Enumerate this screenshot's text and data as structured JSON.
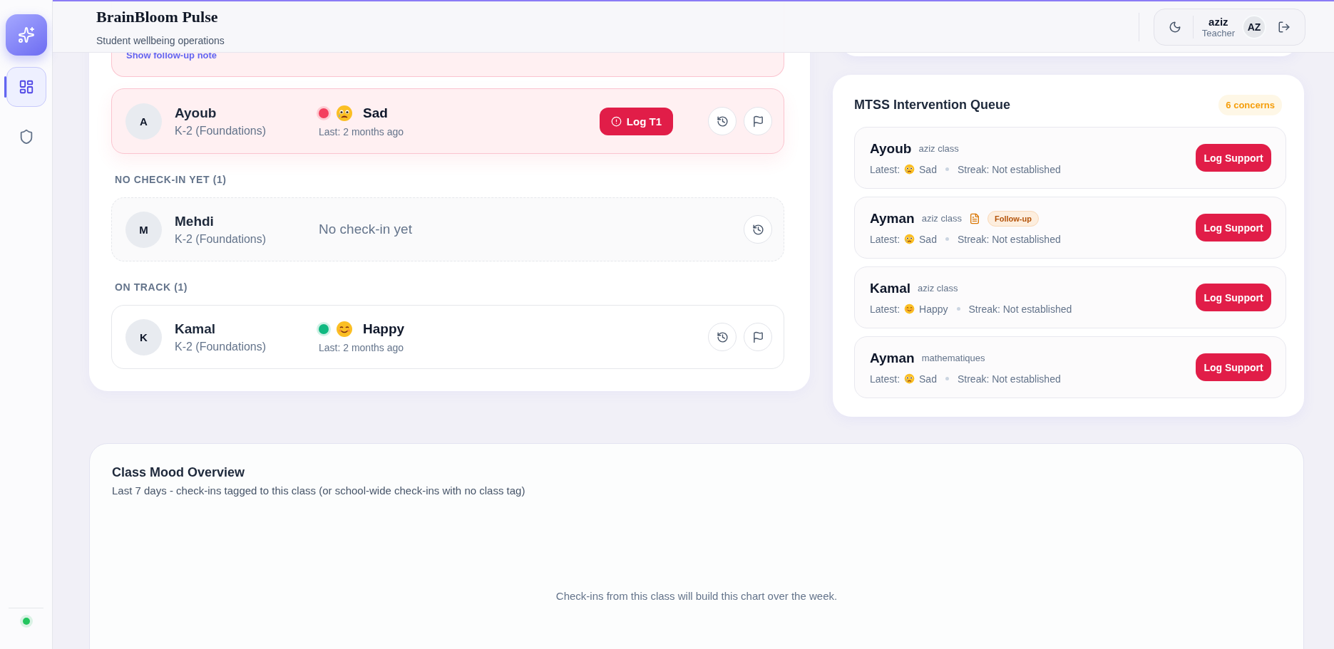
{
  "app": {
    "title": "BrainBloom Pulse",
    "subtitle": "Student wellbeing operations"
  },
  "sidebar": {
    "items": [
      {
        "kind": "dashboard",
        "selected": true
      },
      {
        "kind": "shield",
        "selected": false
      }
    ],
    "online": true
  },
  "user": {
    "name": "aziz",
    "role": "Teacher",
    "initials": "AZ"
  },
  "roster": {
    "follow_up_link": "Show follow-up note",
    "groups": [
      {
        "students": [
          {
            "initial": "A",
            "name": "Ayoub",
            "grade": "K-2 (Foundations)",
            "concern": true,
            "checkin": {
              "mood": "Sad",
              "kind": "sad",
              "color": "#f43f5e",
              "last": "Last: 2 months ago"
            },
            "log_button": "Log T1",
            "actions": [
              {
                "kind": "history"
              },
              {
                "kind": "flag"
              }
            ]
          }
        ]
      },
      {
        "label": "NO CHECK-IN YET (1)",
        "students": [
          {
            "initial": "M",
            "name": "Mehdi",
            "grade": "K-2 (Foundations)",
            "concern": false,
            "empty_text": "No check-in yet",
            "actions": [
              {
                "kind": "history"
              }
            ]
          }
        ]
      },
      {
        "label": "ON TRACK (1)",
        "students": [
          {
            "initial": "K",
            "name": "Kamal",
            "grade": "K-2 (Foundations)",
            "concern": false,
            "checkin": {
              "mood": "Happy",
              "kind": "happy",
              "color": "#10b981",
              "last": "Last: 2 months ago"
            },
            "actions": [
              {
                "kind": "history"
              },
              {
                "kind": "flag"
              }
            ]
          }
        ]
      }
    ]
  },
  "queue": {
    "title": "MTSS Intervention Queue",
    "count": "6 concerns",
    "items": [
      {
        "name": "Ayoub",
        "class": "aziz class",
        "latest_label": "Latest:",
        "mood": "Sad",
        "kind": "sad",
        "streak": "Streak: Not established",
        "button": "Log Support"
      },
      {
        "name": "Ayman",
        "class": "aziz class",
        "follow_up": "Follow-up",
        "latest_label": "Latest:",
        "mood": "Sad",
        "kind": "sad",
        "streak": "Streak: Not established",
        "button": "Log Support"
      },
      {
        "name": "Kamal",
        "class": "aziz class",
        "latest_label": "Latest:",
        "mood": "Happy",
        "kind": "happy",
        "streak": "Streak: Not established",
        "button": "Log Support"
      },
      {
        "name": "Ayman",
        "class": "mathematiques",
        "latest_label": "Latest:",
        "mood": "Sad",
        "kind": "sad",
        "streak": "Streak: Not established",
        "button": "Log Support"
      }
    ]
  },
  "mood_overview": {
    "title": "Class Mood Overview",
    "subtitle": "Last 7 days - check-ins tagged to this class (or school-wide check-ins with no class tag)",
    "empty_text": "Check-ins from this class will build this chart over the week."
  }
}
